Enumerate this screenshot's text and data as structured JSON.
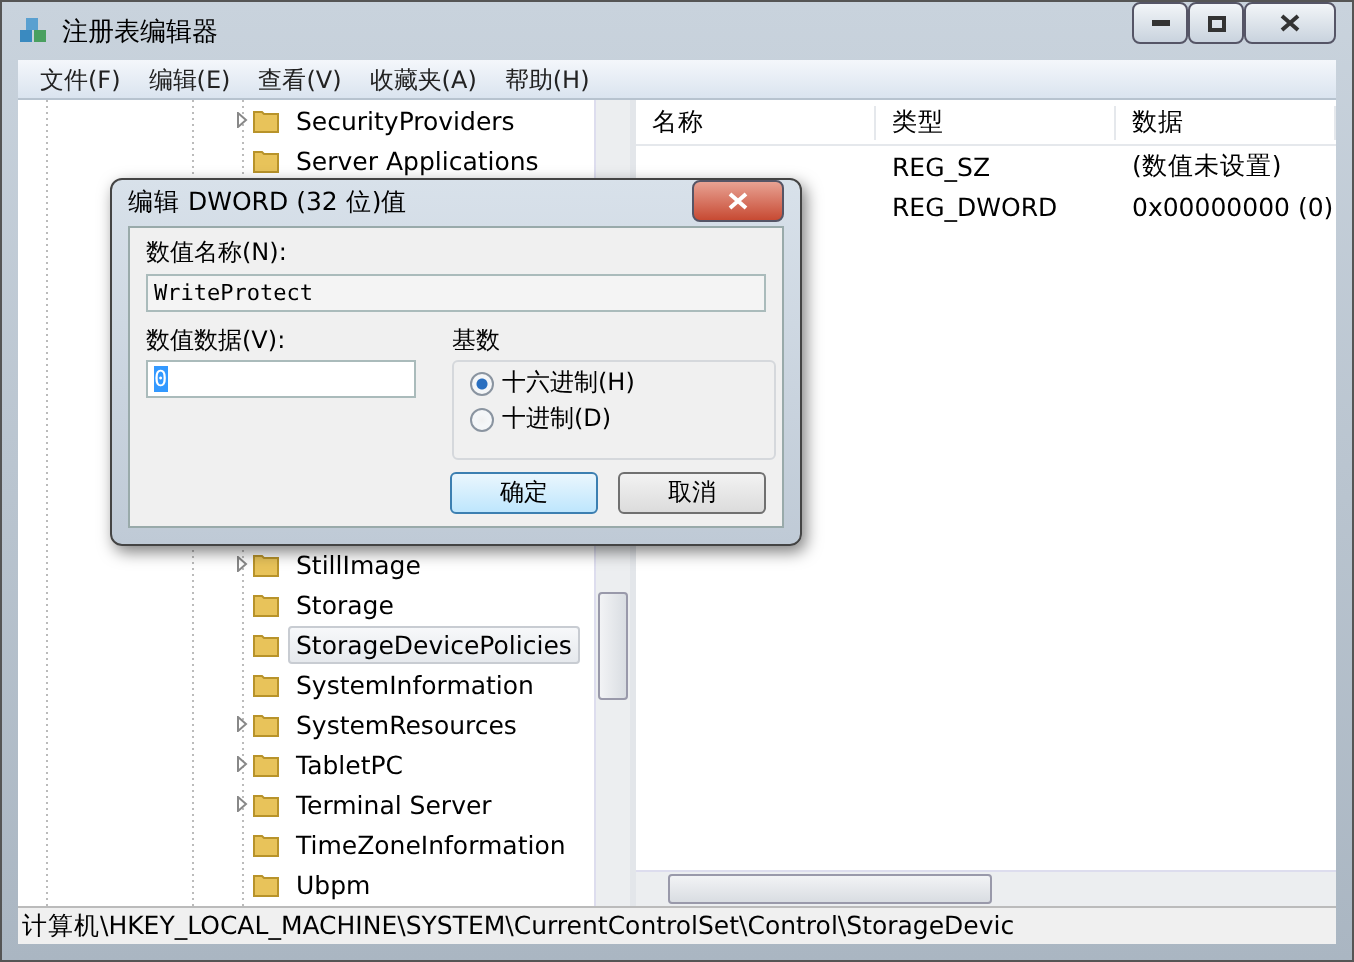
{
  "window": {
    "title": "注册表编辑器"
  },
  "menu": [
    "文件(F)",
    "编辑(E)",
    "查看(V)",
    "收藏夹(A)",
    "帮助(H)"
  ],
  "tree": {
    "items": [
      {
        "label": "SecurityProviders",
        "expandable": true,
        "selected": false,
        "gap_before": false
      },
      {
        "label": "Server Applications",
        "expandable": false,
        "selected": false,
        "gap_before": false
      },
      {
        "label": "StillImage",
        "expandable": true,
        "selected": false,
        "gap_before": true
      },
      {
        "label": "Storage",
        "expandable": false,
        "selected": false,
        "gap_before": false
      },
      {
        "label": "StorageDevicePolicies",
        "expandable": false,
        "selected": true,
        "gap_before": false
      },
      {
        "label": "SystemInformation",
        "expandable": false,
        "selected": false,
        "gap_before": false
      },
      {
        "label": "SystemResources",
        "expandable": true,
        "selected": false,
        "gap_before": false
      },
      {
        "label": "TabletPC",
        "expandable": true,
        "selected": false,
        "gap_before": false
      },
      {
        "label": "Terminal Server",
        "expandable": true,
        "selected": false,
        "gap_before": false
      },
      {
        "label": "TimeZoneInformation",
        "expandable": false,
        "selected": false,
        "gap_before": false
      },
      {
        "label": "Ubpm",
        "expandable": false,
        "selected": false,
        "gap_before": false
      }
    ]
  },
  "values": {
    "columns": [
      "名称",
      "类型",
      "数据"
    ],
    "rows": [
      {
        "type": "REG_SZ",
        "data": "(数值未设置)"
      },
      {
        "type": "REG_DWORD",
        "data": "0x00000000 (0)"
      }
    ]
  },
  "status_bar": "计算机\\HKEY_LOCAL_MACHINE\\SYSTEM\\CurrentControlSet\\Control\\StorageDevic",
  "dialog": {
    "title": "编辑 DWORD (32 位)值",
    "name_label": "数值名称(N):",
    "name_value": "WriteProtect",
    "data_label": "数值数据(V):",
    "data_value": "0",
    "base_label": "基数",
    "bases": [
      {
        "label": "十六进制(H)",
        "selected": true
      },
      {
        "label": "十进制(D)",
        "selected": false
      }
    ],
    "buttons": [
      {
        "label": "确定",
        "default": true
      },
      {
        "label": "取消",
        "default": false
      }
    ]
  }
}
